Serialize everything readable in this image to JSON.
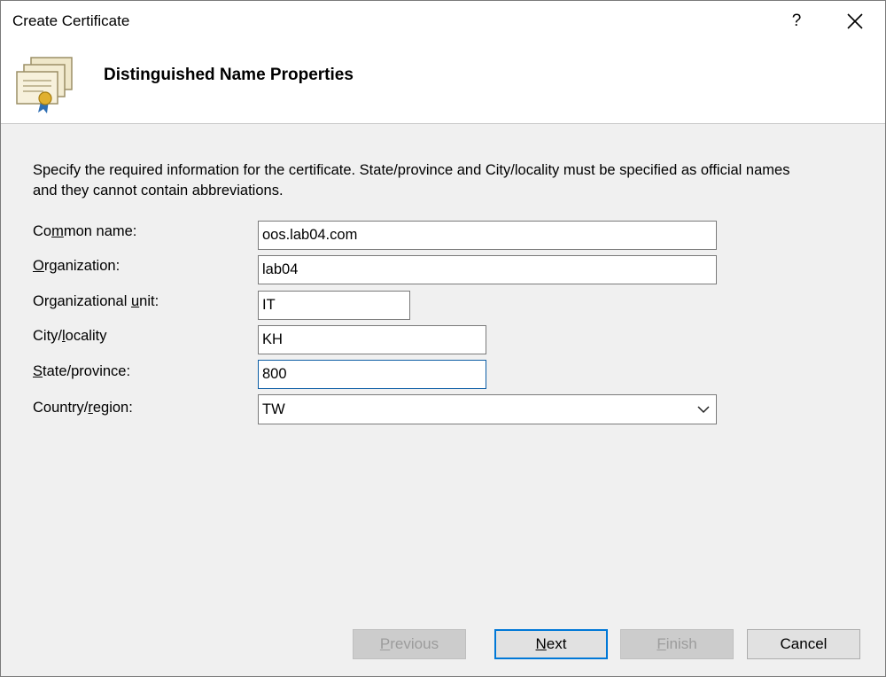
{
  "window": {
    "title": "Create Certificate",
    "help_label": "?",
    "close_label": "close"
  },
  "header": {
    "title": "Distinguished Name Properties",
    "icon": "certificate-icon"
  },
  "intro_text": "Specify the required information for the certificate. State/province and City/locality must be specified as official names and they cannot contain abbreviations.",
  "fields": {
    "common_name": {
      "label_pre": "Co",
      "label_key": "m",
      "label_post": "mon name:",
      "value": "oos.lab04.com"
    },
    "organization": {
      "label_pre": "",
      "label_key": "O",
      "label_post": "rganization:",
      "value": "lab04"
    },
    "org_unit": {
      "label_pre": "Organizational ",
      "label_key": "u",
      "label_post": "nit:",
      "value": "IT"
    },
    "city": {
      "label_pre": "City/",
      "label_key": "l",
      "label_post": "ocality",
      "value": "KH"
    },
    "state": {
      "label_pre": "",
      "label_key": "S",
      "label_post": "tate/province:",
      "value": "800"
    },
    "country": {
      "label_pre": "Country/",
      "label_key": "r",
      "label_post": "egion:",
      "value": "TW"
    }
  },
  "buttons": {
    "previous": {
      "pre": "",
      "key": "P",
      "post": "revious"
    },
    "next": {
      "pre": "",
      "key": "N",
      "post": "ext"
    },
    "finish": {
      "pre": "",
      "key": "F",
      "post": "inish"
    },
    "cancel": {
      "label": "Cancel"
    }
  },
  "colors": {
    "accent": "#0078d7",
    "focus_border": "#0c5da5",
    "dialog_bg": "#f0f0f0"
  }
}
